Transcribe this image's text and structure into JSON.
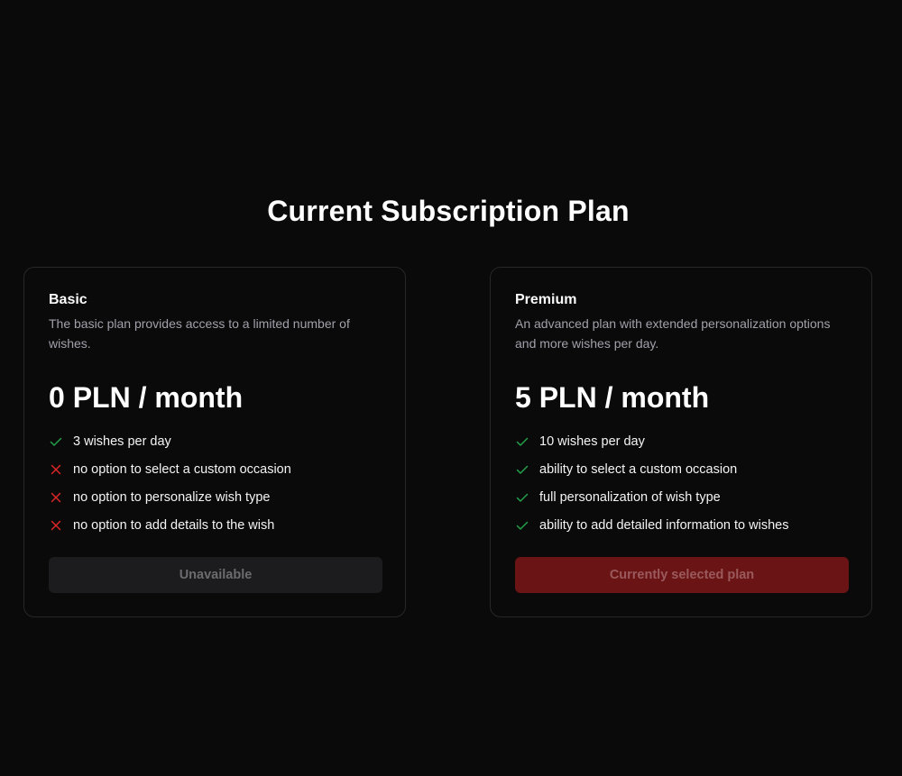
{
  "page": {
    "title": "Current Subscription Plan"
  },
  "colors": {
    "background": "#0a0a0b",
    "card_border": "#27272a",
    "check": "#22a04a",
    "cross": "#dc2626",
    "selected_button": "#6b1416",
    "unavailable_button": "#1c1c1e"
  },
  "plans": [
    {
      "name": "Basic",
      "description": "The basic plan provides access to a limited number of wishes.",
      "price": "0 PLN / month",
      "features": [
        {
          "text": "3 wishes per day",
          "included": true,
          "icon": "check-icon"
        },
        {
          "text": "no option to select a custom occasion",
          "included": false,
          "icon": "cross-icon"
        },
        {
          "text": "no option to personalize wish type",
          "included": false,
          "icon": "cross-icon"
        },
        {
          "text": "no option to add details to the wish",
          "included": false,
          "icon": "cross-icon"
        }
      ],
      "button_label": "Unavailable"
    },
    {
      "name": "Premium",
      "description": "An advanced plan with extended personalization options and more wishes per day.",
      "price": "5 PLN / month",
      "features": [
        {
          "text": "10 wishes per day",
          "included": true,
          "icon": "check-icon"
        },
        {
          "text": "ability to select a custom occasion",
          "included": true,
          "icon": "check-icon"
        },
        {
          "text": "full personalization of wish type",
          "included": true,
          "icon": "check-icon"
        },
        {
          "text": "ability to add detailed information to wishes",
          "included": true,
          "icon": "check-icon"
        }
      ],
      "button_label": "Currently selected plan"
    }
  ]
}
